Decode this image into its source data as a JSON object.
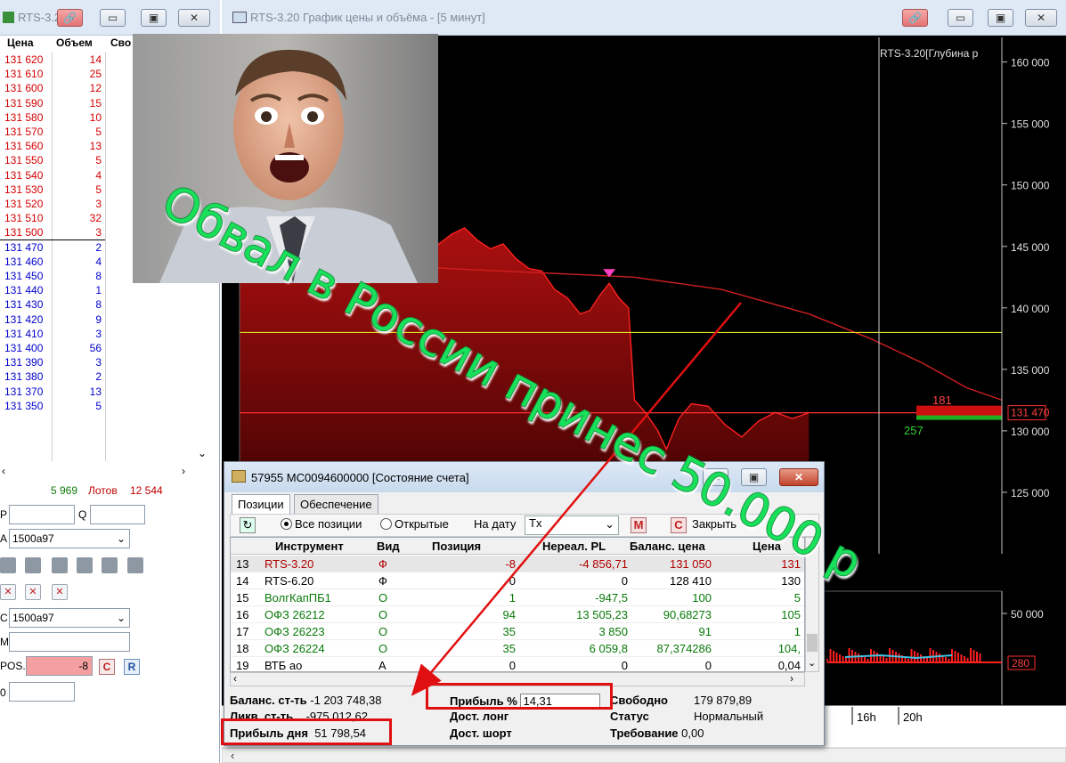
{
  "book": {
    "title": "RTS-3.20",
    "headers": [
      "Цена",
      "Объем",
      "Сво"
    ],
    "asks": [
      [
        "131 620",
        "14"
      ],
      [
        "131 610",
        "25"
      ],
      [
        "131 600",
        "12"
      ],
      [
        "131 590",
        "15"
      ],
      [
        "131 580",
        "10"
      ],
      [
        "131 570",
        "5"
      ],
      [
        "131 560",
        "13"
      ],
      [
        "131 550",
        "5"
      ],
      [
        "131 540",
        "4"
      ],
      [
        "131 530",
        "5"
      ],
      [
        "131 520",
        "3"
      ],
      [
        "131 510",
        "32"
      ],
      [
        "131 500",
        "3"
      ]
    ],
    "bids": [
      [
        "131 470",
        "2"
      ],
      [
        "131 460",
        "4"
      ],
      [
        "131 450",
        "8"
      ],
      [
        "131 440",
        "1"
      ],
      [
        "131 430",
        "8"
      ],
      [
        "131 420",
        "9"
      ],
      [
        "131 410",
        "3"
      ],
      [
        "131 400",
        "56"
      ],
      [
        "131 390",
        "3"
      ],
      [
        "131 380",
        "2"
      ],
      [
        "131 370",
        "13"
      ],
      [
        "131 350",
        "5"
      ]
    ],
    "lots_value": "5 969",
    "lots_label": "Лотов",
    "lots_value2": "12 544",
    "label_p": "P",
    "label_q": "Q",
    "label_a": "A",
    "account1": "1500a97",
    "label_c": "C",
    "account2": "1500a97",
    "label_m": "M",
    "label_pos": "POS.",
    "pos_value": "-8",
    "btn_c": "C",
    "btn_r": "R",
    "label_0": "0"
  },
  "chart": {
    "title": "RTS-3.20 График цены и объёма - [5 минут]",
    "depth_label": "RTS-3.20[Глубина р",
    "y_ticks": [
      "160 000",
      "155 000",
      "150 000",
      "145 000",
      "140 000",
      "135 000",
      "130 000",
      "125 000"
    ],
    "current_price": "131 470",
    "label_181": "181",
    "label_257": "257",
    "vol_tick": "50 000",
    "vol_current": "280",
    "x_ticks": [
      "16h",
      "20h"
    ]
  },
  "chart_data": {
    "type": "line",
    "title": "RTS-3.20 График цены и объёма - [5 минут]",
    "ylim": [
      120000,
      162000
    ],
    "y_ticks": [
      125000,
      130000,
      135000,
      140000,
      145000,
      150000,
      155000,
      160000
    ],
    "price_series": [
      [
        0,
        144500
      ],
      [
        20,
        146000
      ],
      [
        40,
        147500
      ],
      [
        60,
        145000
      ],
      [
        80,
        143000
      ],
      [
        100,
        144000
      ],
      [
        120,
        143500
      ],
      [
        140,
        142500
      ],
      [
        160,
        144000
      ],
      [
        180,
        143000
      ],
      [
        200,
        142000
      ],
      [
        230,
        142500
      ],
      [
        260,
        143200
      ],
      [
        290,
        144000
      ],
      [
        310,
        145200
      ],
      [
        330,
        146000
      ],
      [
        350,
        146500
      ],
      [
        370,
        145500
      ],
      [
        390,
        144800
      ],
      [
        410,
        145200
      ],
      [
        430,
        144000
      ],
      [
        450,
        143200
      ],
      [
        470,
        143000
      ],
      [
        490,
        141500
      ],
      [
        510,
        140800
      ],
      [
        530,
        139500
      ],
      [
        545,
        139800
      ],
      [
        560,
        141000
      ],
      [
        575,
        142000
      ],
      [
        590,
        140800
      ],
      [
        605,
        140000
      ],
      [
        612,
        132500
      ],
      [
        625,
        131500
      ],
      [
        640,
        130000
      ],
      [
        650,
        128500
      ],
      [
        665,
        131000
      ],
      [
        680,
        132200
      ],
      [
        700,
        132000
      ],
      [
        720,
        130500
      ],
      [
        740,
        129500
      ],
      [
        760,
        130800
      ],
      [
        780,
        131500
      ],
      [
        800,
        131000
      ],
      [
        820,
        131470
      ]
    ],
    "ma_series": [
      [
        0,
        145000
      ],
      [
        150,
        143500
      ],
      [
        300,
        143000
      ],
      [
        450,
        142500
      ],
      [
        550,
        141500
      ],
      [
        650,
        139500
      ],
      [
        720,
        137500
      ],
      [
        780,
        135500
      ],
      [
        830,
        133500
      ],
      [
        870,
        132500
      ]
    ],
    "level_yellow": 138000,
    "level_red": 131470,
    "marker_price": 142000
  },
  "account": {
    "title": "57955 MC0094600000 [Состояние счета]",
    "tabs": [
      "Позиции",
      "Обеспечение"
    ],
    "radio_all": "Все позиции",
    "radio_open": "Открытые",
    "on_date": "На дату",
    "tx": "Tx",
    "btn_m": "M",
    "btn_close_c": "C",
    "btn_close": "Закрыть",
    "headers": [
      "Инструмент",
      "Вид",
      "Позиция",
      "Нереал. PL",
      "Баланс. цена",
      "Цена"
    ],
    "rows": [
      {
        "n": "13",
        "name": "RTS-3.20",
        "kind": "Ф",
        "pos": "-8",
        "pl": "-4 856,71",
        "bal": "131 050",
        "price": "131"
      },
      {
        "n": "14",
        "name": "RTS-6.20",
        "kind": "Ф",
        "pos": "0",
        "pl": "0",
        "bal": "128 410",
        "price": "130"
      },
      {
        "n": "15",
        "name": "ВолгКапПБ1",
        "kind": "О",
        "pos": "1",
        "pl": "-947,5",
        "bal": "100",
        "price": "5"
      },
      {
        "n": "16",
        "name": "ОФЗ 26212",
        "kind": "О",
        "pos": "94",
        "pl": "13 505,23",
        "bal": "90,68273",
        "price": "105"
      },
      {
        "n": "17",
        "name": "ОФЗ 26223",
        "kind": "О",
        "pos": "35",
        "pl": "3 850",
        "bal": "91",
        "price": "1"
      },
      {
        "n": "18",
        "name": "ОФЗ 26224",
        "kind": "О",
        "pos": "35",
        "pl": "6 059,8",
        "bal": "87,374286",
        "price": "104,"
      },
      {
        "n": "19",
        "name": "ВТБ ао",
        "kind": "А",
        "pos": "0",
        "pl": "0",
        "bal": "0",
        "price": "0,04"
      }
    ],
    "summary": {
      "bal_label": "Баланс. ст-ть",
      "bal_value": "-1 203 748,38",
      "liq_label": "Ликв. ст-ть",
      "liq_value": "-975 012,62",
      "day_label": "Прибыль дня",
      "day_value": "51 798,54",
      "pct_label": "Прибыль %",
      "pct_value": "14,31",
      "long_label": "Дост. лонг",
      "short_label": "Дост. шорт",
      "free_label": "Свободно",
      "free_value": "179 879,89",
      "status_label": "Статус",
      "status_value": "Нормальный",
      "req_label": "Требование",
      "req_value": "0,00"
    }
  },
  "overlay_text": "Обвал в  России  принес 50.000 р",
  "colors": {
    "ask": "#d40000",
    "bid": "#0000cc",
    "price_fill": "#8b0000",
    "overlay_text": "#19e05a",
    "annotation": "#e01010"
  }
}
